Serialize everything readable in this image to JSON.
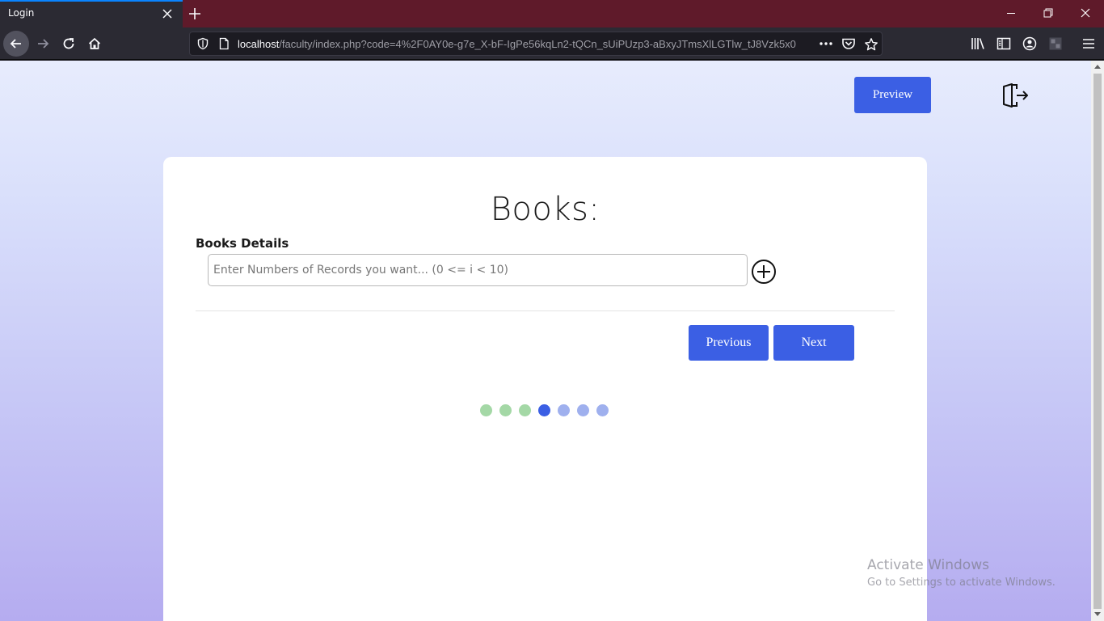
{
  "browser": {
    "tab_title": "Login",
    "url_host": "localhost",
    "url_path": "/faculty/index.php?code=4%2F0AY0e-g7e_X-bF-IgPe56kqLn2-tQCn_sUiPUzp3-aBxyJTmsXlLGTlw_tJ8Vzk5x0"
  },
  "header": {
    "preview_label": "Preview"
  },
  "form": {
    "title": "Books:",
    "section_label": "Books Details",
    "records_placeholder": "Enter Numbers of Records you want... (0 <= i < 10)",
    "records_value": ""
  },
  "actions": {
    "previous_label": "Previous",
    "next_label": "Next"
  },
  "progress": {
    "total_steps": 7,
    "current_step": 4,
    "completed_color": "#a4d8a6",
    "current_color": "#3b5fe4",
    "pending_color": "#9fb0ee"
  },
  "watermark": {
    "title": "Activate Windows",
    "subtitle": "Go to Settings to activate Windows."
  },
  "colors": {
    "accent": "#3b5fe4",
    "tabbar": "#5f1a2a"
  }
}
